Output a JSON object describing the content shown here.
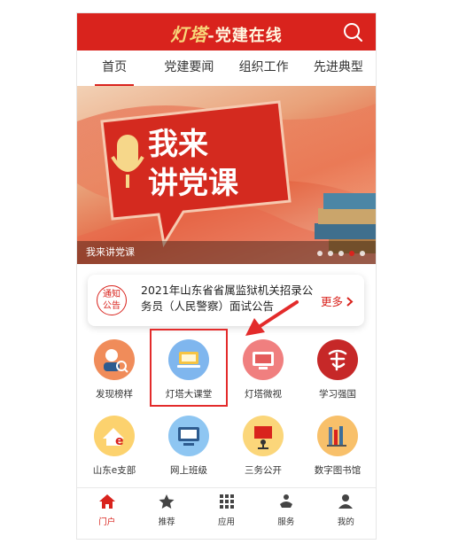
{
  "header": {
    "logo_text": "灯塔",
    "app_name": "-党建在线",
    "search_icon": "search-icon"
  },
  "tabs": [
    {
      "label": "首页",
      "active": true
    },
    {
      "label": "党建要闻",
      "active": false
    },
    {
      "label": "组织工作",
      "active": false
    },
    {
      "label": "先进典型",
      "active": false
    }
  ],
  "banner": {
    "title_line1": "我来",
    "title_line2": "讲党课",
    "caption": "我来讲党课",
    "dots_total": 5,
    "dot_active_index": 3
  },
  "notice": {
    "badge_line1": "通知",
    "badge_line2": "公告",
    "text": "2021年山东省省属监狱机关招录公务员（人民警察）面试公告",
    "more_label": "更多"
  },
  "grid": [
    {
      "label": "发现榜样",
      "icon": "role-model-icon",
      "color": "#f08c5a"
    },
    {
      "label": "灯塔大课堂",
      "icon": "classroom-icon",
      "color": "#7fb6ee"
    },
    {
      "label": "灯塔微视",
      "icon": "micro-video-icon",
      "color": "#f07f7f"
    },
    {
      "label": "学习强国",
      "icon": "xuexi-qiangguo-icon",
      "color": "#c62828"
    },
    {
      "label": "山东e支部",
      "icon": "e-branch-icon",
      "color": "#fcd26e"
    },
    {
      "label": "网上班级",
      "icon": "online-class-icon",
      "color": "#8ec6f2"
    },
    {
      "label": "三务公开",
      "icon": "public-affairs-icon",
      "color": "#fbd67a"
    },
    {
      "label": "数字图书馆",
      "icon": "digital-library-icon",
      "color": "#f8c06a"
    }
  ],
  "bottom_nav": [
    {
      "label": "门户",
      "icon": "home-icon",
      "active": true
    },
    {
      "label": "推荐",
      "icon": "star-icon",
      "active": false
    },
    {
      "label": "应用",
      "icon": "apps-icon",
      "active": false
    },
    {
      "label": "服务",
      "icon": "service-icon",
      "active": false
    },
    {
      "label": "我的",
      "icon": "user-icon",
      "active": false
    }
  ],
  "colors": {
    "brand_red": "#d9231d",
    "highlight_red": "#e32b2b"
  }
}
